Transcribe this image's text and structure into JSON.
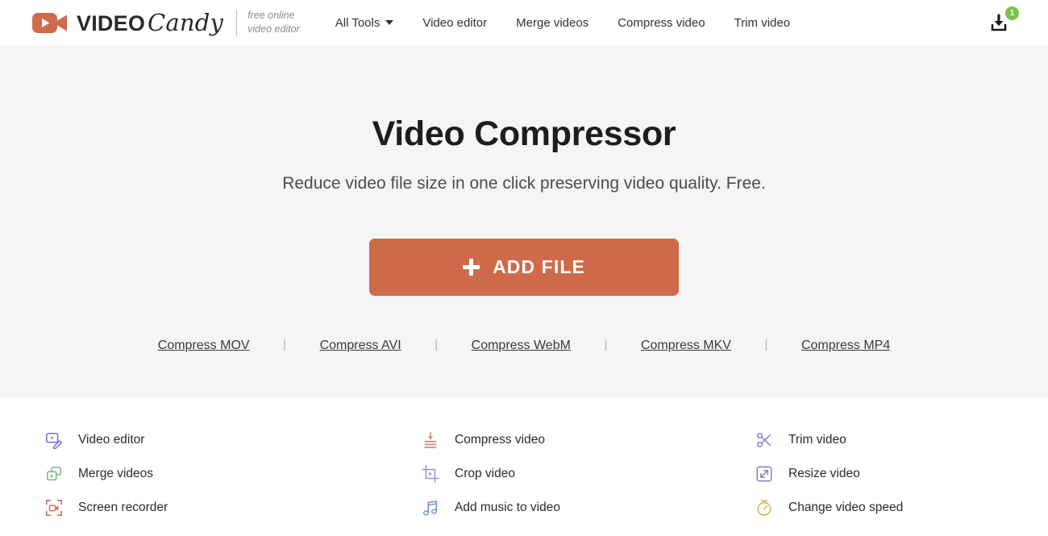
{
  "header": {
    "logo": {
      "icon": "video-camera-icon",
      "word_primary": "VIDEO",
      "word_secondary": "Candy",
      "tagline_line1": "free online",
      "tagline_line2": "video editor"
    },
    "nav": [
      {
        "label": "All Tools",
        "has_caret": true
      },
      {
        "label": "Video editor",
        "has_caret": false
      },
      {
        "label": "Merge videos",
        "has_caret": false
      },
      {
        "label": "Compress video",
        "has_caret": false
      },
      {
        "label": "Trim video",
        "has_caret": false
      }
    ],
    "downloads": {
      "icon": "download-icon",
      "badge_count": "1",
      "badge_color": "#7cbf4d"
    }
  },
  "hero": {
    "title": "Video Compressor",
    "subtitle": "Reduce video file size in one click preserving video quality. Free.",
    "add_file_button": {
      "label": "ADD FILE",
      "icon": "plus-icon",
      "color": "#cf6a4b"
    },
    "format_links": [
      "Compress MOV",
      "Compress AVI",
      "Compress WebM",
      "Compress MKV",
      "Compress MP4"
    ],
    "separator": "|",
    "background_color": "#f5f5f5"
  },
  "tools": [
    {
      "label": "Video editor",
      "icon": "video-editor-icon",
      "color": "#7b71c9"
    },
    {
      "label": "Compress video",
      "icon": "compress-icon",
      "color": "#c98b7e"
    },
    {
      "label": "Trim video",
      "icon": "scissors-icon",
      "color": "#8a82cc"
    },
    {
      "label": "Merge videos",
      "icon": "merge-icon",
      "color": "#77b87f"
    },
    {
      "label": "Crop video",
      "icon": "crop-icon",
      "color": "#9a8fd0"
    },
    {
      "label": "Resize video",
      "icon": "resize-icon",
      "color": "#8a82cc"
    },
    {
      "label": "Screen recorder",
      "icon": "screen-recorder-icon",
      "color": "#cf6a5b"
    },
    {
      "label": "Add music to video",
      "icon": "music-note-icon",
      "color": "#6f93c9"
    },
    {
      "label": "Change video speed",
      "icon": "timer-icon",
      "color": "#d8b34a"
    }
  ]
}
